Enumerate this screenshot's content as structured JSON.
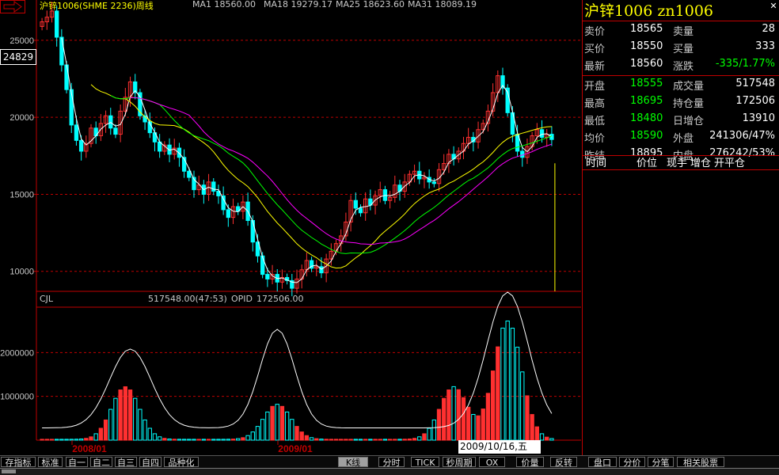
{
  "chart_data": [
    {
      "type": "candlestick",
      "title": "沪锌1006(SHME 2236)周线",
      "ylim": [
        8700,
        27000
      ],
      "yticks": [
        10000,
        15000,
        20000,
        25000
      ],
      "ytick_labels": [
        "10000",
        "15000",
        "20000",
        "25000"
      ],
      "x_period_labels": [
        "2008/01",
        "2009/01"
      ],
      "current_price_tag": "24829",
      "date_cursor": "2009/10/16,五",
      "ma_legend": [
        {
          "text": "MA1 18560.00",
          "color": "#ffffff"
        },
        {
          "text": "MA18 19279.17",
          "color": "#ffff00"
        },
        {
          "text": "MA25 18623.60",
          "color": "#00ff00"
        },
        {
          "text": "MA31 18089.19",
          "color": "#ff00ff"
        }
      ],
      "close_series": [
        26200,
        26500,
        26900,
        25200,
        23400,
        21800,
        19500,
        18500,
        17800,
        18300,
        19300,
        18800,
        19600,
        20100,
        19300,
        18900,
        20400,
        21300,
        22300,
        21600,
        20100,
        19700,
        19000,
        18400,
        17800,
        18200,
        17600,
        18000,
        17400,
        16500,
        16100,
        15300,
        15600,
        15000,
        15800,
        15200,
        14900,
        14000,
        13500,
        14200,
        13900,
        14500,
        13300,
        11900,
        11000,
        9800,
        9500,
        9800,
        9300,
        9600,
        9400,
        8900,
        9500,
        10100,
        10700,
        10200,
        10300,
        9900,
        10800,
        11300,
        11800,
        12300,
        13200,
        14600,
        14100,
        13800,
        14700,
        14300,
        14900,
        15300,
        14600,
        14800,
        15600,
        15200,
        15800,
        16300,
        16500,
        16000,
        16100,
        15800,
        15700,
        16600,
        17000,
        17600,
        17300,
        17800,
        18300,
        18700,
        18400,
        19200,
        19600,
        20400,
        21600,
        22700,
        21900,
        20300,
        18900,
        17800,
        17400,
        18100,
        18800,
        19200,
        18700,
        18900,
        18560
      ],
      "volume_series": [
        {
          "name": "CJL",
          "value_text": "517548.00(47:53)",
          "color": "#c8c8c8"
        },
        {
          "name": "OPID",
          "value_text": "172506.00",
          "color": "#c8c8c8"
        }
      ],
      "volume_yticks": [
        "1000000",
        "2000000"
      ],
      "volume_ylim": [
        0,
        3000000
      ]
    }
  ],
  "quote": {
    "title": "沪锌1006  zn1006",
    "rows": [
      {
        "l1": "卖价",
        "v1": "18565",
        "v1c": "#ffffff",
        "l2": "卖量",
        "v2": "28",
        "v2c": "#ffffff"
      },
      {
        "l1": "买价",
        "v1": "18550",
        "v1c": "#ffffff",
        "l2": "买量",
        "v2": "333",
        "v2c": "#ffffff"
      },
      {
        "l1": "最新",
        "v1": "18560",
        "v1c": "#ffffff",
        "l2": "涨跌",
        "v2": "-335/1.77%",
        "v2c": "#00ff00"
      },
      {
        "l1": "开盘",
        "v1": "18555",
        "v1c": "#00ff00",
        "l2": "成交量",
        "v2": "517548",
        "v2c": "#ffffff"
      },
      {
        "l1": "最高",
        "v1": "18695",
        "v1c": "#00ff00",
        "l2": "持仓量",
        "v2": "172506",
        "v2c": "#ffffff"
      },
      {
        "l1": "最低",
        "v1": "18480",
        "v1c": "#00ff00",
        "l2": "日增仓",
        "v2": "13910",
        "v2c": "#ffffff"
      },
      {
        "l1": "均价",
        "v1": "18590",
        "v1c": "#00ff00",
        "l2": "外盘",
        "v2": "241306/47%",
        "v2c": "#ffffff"
      },
      {
        "l1": "昨结",
        "v1": "18895",
        "v1c": "#ffffff",
        "l2": "内盘",
        "v2": "276242/53%",
        "v2c": "#ffffff"
      }
    ],
    "tick_header": [
      "时间",
      "价位",
      "现手",
      "增仓",
      "开平仓"
    ]
  },
  "tabs": [
    {
      "label": "存指标",
      "active": false
    },
    {
      "label": "标准",
      "active": false
    },
    {
      "label": "自一",
      "active": false
    },
    {
      "label": "自二",
      "active": false
    },
    {
      "label": "自三",
      "active": false
    },
    {
      "label": "自四",
      "active": false
    },
    {
      "label": "品种化",
      "active": false
    },
    {
      "label": "K线",
      "active": true
    },
    {
      "label": "分时",
      "active": false
    },
    {
      "label": "TICK",
      "active": false
    },
    {
      "label": "秒周期",
      "active": false
    },
    {
      "label": "OX",
      "active": false
    },
    {
      "label": "价量",
      "active": false
    },
    {
      "label": "反转",
      "active": false
    },
    {
      "label": "盘口",
      "active": false
    },
    {
      "label": "分价",
      "active": false
    },
    {
      "label": "分笔",
      "active": false
    },
    {
      "label": "相关股票",
      "active": false
    }
  ],
  "colors": {
    "up": "#ff3030",
    "down": "#00ffff",
    "grid": "#c00000",
    "bg": "#000000"
  }
}
